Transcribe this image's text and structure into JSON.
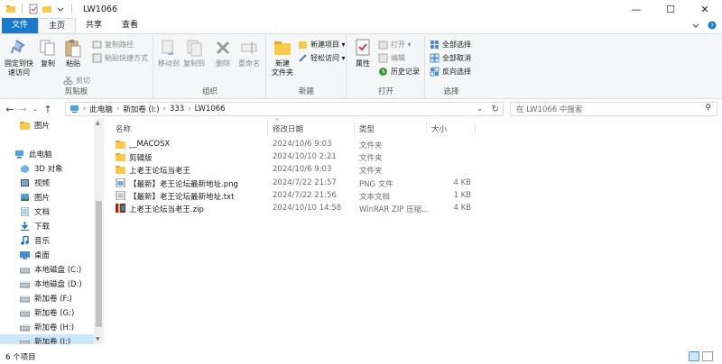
{
  "window": {
    "title": "LW1066",
    "minimize": "—",
    "maximize": "☐",
    "close": "✕"
  },
  "tabs": {
    "file": "文件",
    "home": "主页",
    "share": "共享",
    "view": "查看"
  },
  "ribbon": {
    "clipboard": {
      "pin": "固定到快\n速访问",
      "copy": "复制",
      "paste": "粘贴",
      "copy_path": "复制路径",
      "paste_shortcut": "粘贴快捷方式",
      "cut": "剪切",
      "label": "剪贴板"
    },
    "organize": {
      "move_to": "移动到",
      "copy_to": "复制到",
      "delete": "删除",
      "rename": "重命名",
      "label": "组织"
    },
    "new": {
      "new_folder": "新建\n文件夹",
      "new_item": "新建项目 ▾",
      "easy_access": "轻松访问 ▾",
      "label": "新建"
    },
    "open": {
      "properties": "属性",
      "open": "打开 ▾",
      "edit": "编辑",
      "history": "历史记录",
      "label": "打开"
    },
    "select": {
      "select_all": "全部选择",
      "select_none": "全部取消",
      "invert": "反向选择",
      "label": "选择"
    }
  },
  "address": {
    "crumbs": [
      "此电脑",
      "新加卷 (I:)",
      "333",
      "LW1066"
    ],
    "search_placeholder": "在 LW1066 中搜索"
  },
  "nav": {
    "items": [
      {
        "label": "图片",
        "icon": "folder-icon",
        "indent": 22
      },
      {
        "label": "",
        "icon": "",
        "indent": 0
      },
      {
        "label": "此电脑",
        "icon": "computer-icon",
        "indent": 16
      },
      {
        "label": "3D 对象",
        "icon": "3d-objects-icon",
        "indent": 22
      },
      {
        "label": "视频",
        "icon": "video-icon",
        "indent": 22
      },
      {
        "label": "图片",
        "icon": "pictures-icon",
        "indent": 22
      },
      {
        "label": "文档",
        "icon": "documents-icon",
        "indent": 22
      },
      {
        "label": "下载",
        "icon": "download-icon",
        "indent": 22
      },
      {
        "label": "音乐",
        "icon": "music-icon",
        "indent": 22
      },
      {
        "label": "桌面",
        "icon": "desktop-icon",
        "indent": 22
      },
      {
        "label": "本地磁盘 (C:)",
        "icon": "drive-icon",
        "indent": 22
      },
      {
        "label": "本地磁盘 (D:)",
        "icon": "drive-icon",
        "indent": 22
      },
      {
        "label": "新加卷 (F:)",
        "icon": "drive-icon",
        "indent": 22
      },
      {
        "label": "新加卷 (G:)",
        "icon": "drive-icon",
        "indent": 22
      },
      {
        "label": "新加卷 (H:)",
        "icon": "drive-icon",
        "indent": 22
      },
      {
        "label": "新加卷 (I:)",
        "icon": "drive-icon",
        "indent": 22,
        "selected": true
      }
    ]
  },
  "columns": {
    "name": "名称",
    "date": "修改日期",
    "type": "类型",
    "size": "大小"
  },
  "files": [
    {
      "name": "__MACOSX",
      "date": "2024/10/6 9:03",
      "type": "文件夹",
      "size": "",
      "icon": "folder-icon"
    },
    {
      "name": "剪辑版",
      "date": "2024/10/10 2:21",
      "type": "文件夹",
      "size": "",
      "icon": "folder-icon"
    },
    {
      "name": "上老王论坛当老王",
      "date": "2024/10/6 9:03",
      "type": "文件夹",
      "size": "",
      "icon": "folder-icon"
    },
    {
      "name": "【最新】老王论坛最新地址.png",
      "date": "2024/7/22 21:57",
      "type": "PNG 文件",
      "size": "4 KB",
      "icon": "png-file-icon"
    },
    {
      "name": "【最新】老王论坛最新地址.txt",
      "date": "2024/7/22 21:56",
      "type": "文本文档",
      "size": "1 KB",
      "icon": "txt-file-icon"
    },
    {
      "name": "上老王论坛当老王.zip",
      "date": "2024/10/10 14:58",
      "type": "WinRAR ZIP 压缩...",
      "size": "4 KB",
      "icon": "zip-file-icon"
    }
  ],
  "status": {
    "count": "6 个项目"
  },
  "colors": {
    "accent": "#1979ca",
    "selection": "#cce8ff",
    "folder": "#f8c94a"
  }
}
